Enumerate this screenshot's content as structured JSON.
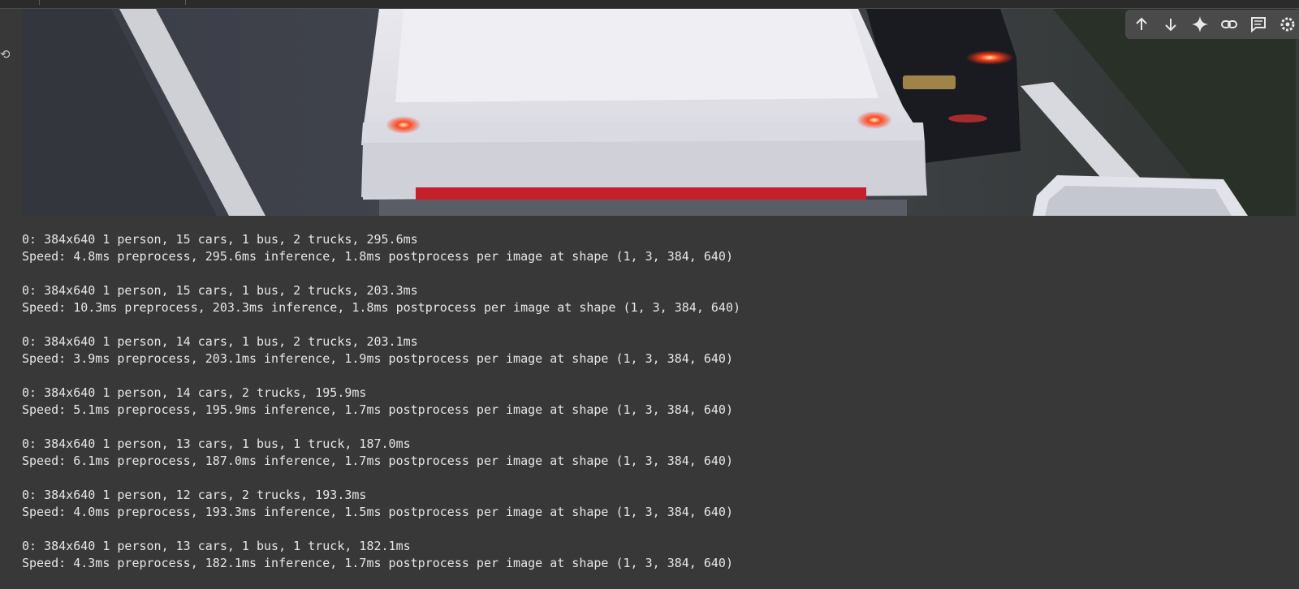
{
  "toolbar": {
    "buttons": [
      {
        "icon": "arrow-up-icon",
        "label": "Move cell up"
      },
      {
        "icon": "arrow-down-icon",
        "label": "Move cell down"
      },
      {
        "icon": "sparkle-icon",
        "label": "Gemini"
      },
      {
        "icon": "link-icon",
        "label": "Copy link to cell"
      },
      {
        "icon": "comment-icon",
        "label": "Add comment"
      },
      {
        "icon": "settings-icon",
        "label": "Settings"
      }
    ]
  },
  "image": {
    "description_icon": "video-frame-image"
  },
  "output_log": [
    {
      "detection": "0: 384x640 1 person, 15 cars, 1 bus, 2 trucks, 295.6ms",
      "speed": "Speed: 4.8ms preprocess, 295.6ms inference, 1.8ms postprocess per image at shape (1, 3, 384, 640)"
    },
    {
      "detection": "0: 384x640 1 person, 15 cars, 1 bus, 2 trucks, 203.3ms",
      "speed": "Speed: 10.3ms preprocess, 203.3ms inference, 1.8ms postprocess per image at shape (1, 3, 384, 640)"
    },
    {
      "detection": "0: 384x640 1 person, 14 cars, 1 bus, 2 trucks, 203.1ms",
      "speed": "Speed: 3.9ms preprocess, 203.1ms inference, 1.9ms postprocess per image at shape (1, 3, 384, 640)"
    },
    {
      "detection": "0: 384x640 1 person, 14 cars, 2 trucks, 195.9ms",
      "speed": "Speed: 5.1ms preprocess, 195.9ms inference, 1.7ms postprocess per image at shape (1, 3, 384, 640)"
    },
    {
      "detection": "0: 384x640 1 person, 13 cars, 1 bus, 1 truck, 187.0ms",
      "speed": "Speed: 6.1ms preprocess, 187.0ms inference, 1.7ms postprocess per image at shape (1, 3, 384, 640)"
    },
    {
      "detection": "0: 384x640 1 person, 12 cars, 2 trucks, 193.3ms",
      "speed": "Speed: 4.0ms preprocess, 193.3ms inference, 1.5ms postprocess per image at shape (1, 3, 384, 640)"
    },
    {
      "detection": "0: 384x640 1 person, 13 cars, 1 bus, 1 truck, 182.1ms",
      "speed": "Speed: 4.3ms preprocess, 182.1ms inference, 1.7ms postprocess per image at shape (1, 3, 384, 640)"
    }
  ]
}
